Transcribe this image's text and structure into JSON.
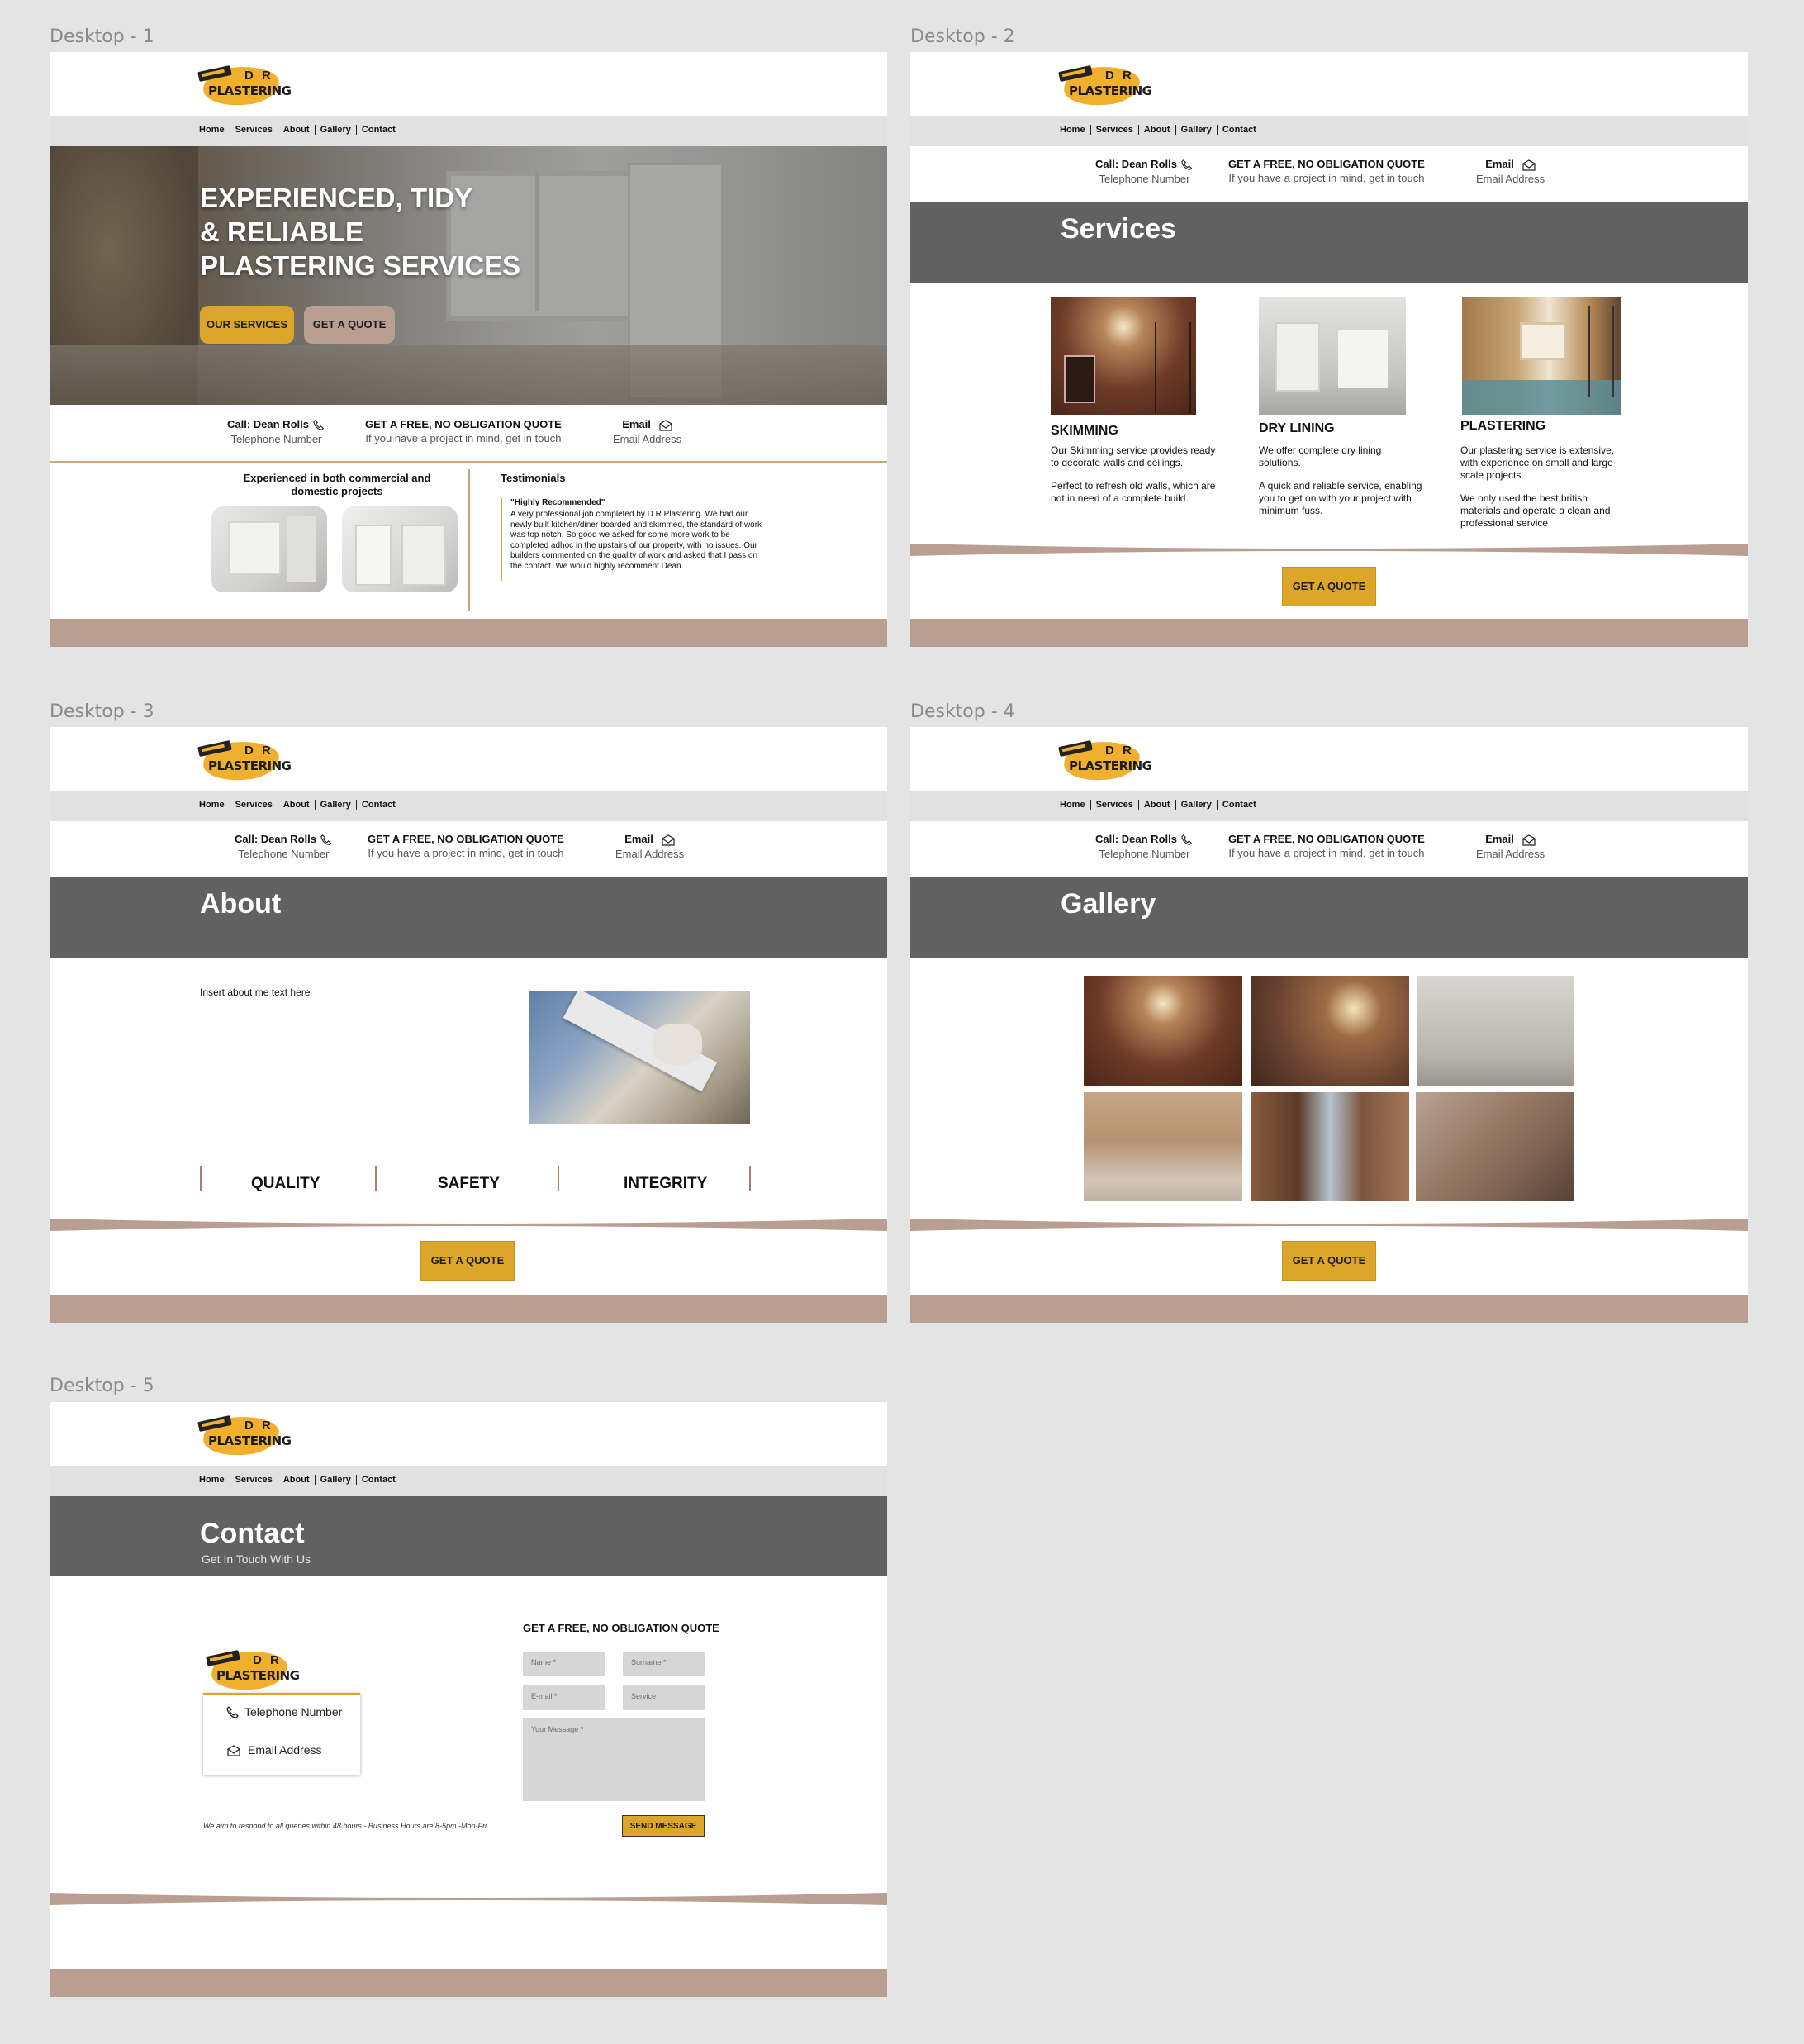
{
  "canvas": {
    "background": "#e4e4e4"
  },
  "brand": {
    "logo_dr": "D R",
    "logo_plastering": "PLASTERING",
    "accent": "#dba62a",
    "footer_color": "#b89f91",
    "banner_color": "#616161"
  },
  "nav": [
    "Home",
    "Services",
    "About",
    "Gallery",
    "Contact"
  ],
  "contact_bar": {
    "call_label": "Call: Dean Rolls",
    "phone": "Telephone Number",
    "quote_title": "GET A FREE, NO OBLIGATION QUOTE",
    "quote_sub": "If you have a project in mind, get in touch",
    "email_label": "Email",
    "email": "Email Address",
    "phone_icon": "phone-icon",
    "email_icon": "email-icon"
  },
  "quote_button": "GET A QUOTE",
  "frames": [
    {
      "label": "Desktop - 1"
    },
    {
      "label": "Desktop - 2"
    },
    {
      "label": "Desktop - 3"
    },
    {
      "label": "Desktop - 4"
    },
    {
      "label": "Desktop - 5"
    }
  ],
  "home": {
    "hero_line1": "EXPERIENCED, TIDY",
    "hero_line2": "& RELIABLE",
    "hero_line3": "PLASTERING SERVICES",
    "btn_services": "OUR SERVICES",
    "btn_quote": "GET A QUOTE",
    "experienced_title": "Experienced in both commercial and domestic projects",
    "testimonials_title": "Testimonials",
    "testimonial_heading": "\"Highly Recommended\"",
    "testimonial_body": "A very professional job completed by D R Plastering. We had our newly built kitchen/diner boarded and skimmed, the standard of work was top notch. So good we asked for some more work to be completed adhoc in the upstairs of our property, with no issues. Our builders commented on the quality of work and asked that I pass on the contact. We would highly recomment Dean."
  },
  "services": {
    "title": "Services",
    "items": [
      {
        "title": "SKIMMING",
        "p1": "Our Skimming service provides ready to decorate walls and ceilings.",
        "p2": "Perfect to refresh old walls, which are not in need of a complete build."
      },
      {
        "title": "DRY LINING",
        "p1": "We offer complete dry lining solutions.",
        "p2": "A quick and reliable service, enabling you to get on with your project with minimum fuss."
      },
      {
        "title": "PLASTERING",
        "p1": "Our plastering service is extensive, with experience on small and large scale projects.",
        "p2": "We only used the best british materials and operate a clean and professional service"
      }
    ]
  },
  "about": {
    "title": "About",
    "text": "Insert about me text here",
    "pillars": [
      "QUALITY",
      "SAFETY",
      "INTEGRITY"
    ]
  },
  "gallery": {
    "title": "Gallery"
  },
  "contact": {
    "title": "Contact",
    "subtitle": "Get In Touch With Us",
    "card_phone": "Telephone Number",
    "card_email": "Email Address",
    "form_title": "GET A FREE, NO OBLIGATION QUOTE",
    "name_placeholder": "Name *",
    "surname_placeholder": "Surname *",
    "email_placeholder": "E-mail *",
    "service_placeholder": "Service",
    "message_placeholder": "Your Message *",
    "note": "We aim to respond to all queries within 48 hours - Business Hours are 8-5pm -Mon-Fri",
    "send": "SEND MESSAGE"
  }
}
